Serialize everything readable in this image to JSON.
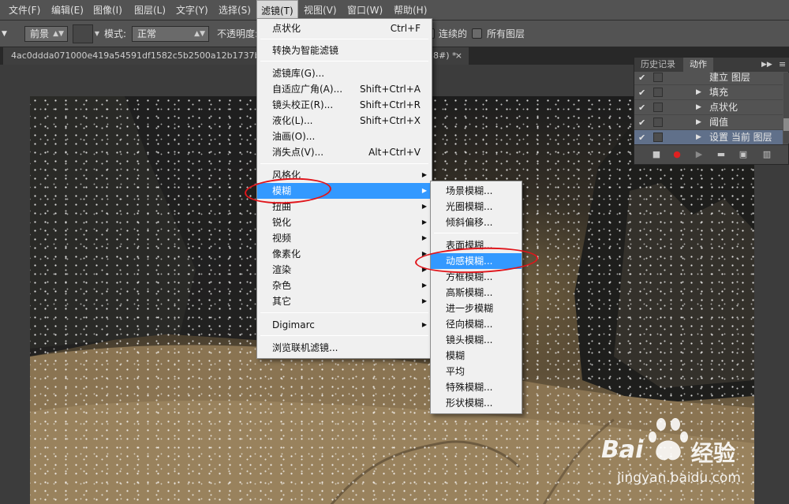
{
  "menubar": {
    "items": [
      {
        "label": "文件(F)"
      },
      {
        "label": "编辑(E)"
      },
      {
        "label": "图像(I)"
      },
      {
        "label": "图层(L)"
      },
      {
        "label": "文字(Y)"
      },
      {
        "label": "选择(S)"
      },
      {
        "label": "滤镜(T)"
      },
      {
        "label": "视图(V)"
      },
      {
        "label": "窗口(W)"
      },
      {
        "label": "帮助(H)"
      }
    ]
  },
  "options": {
    "fill_source": "前景",
    "mode_label": "模式:",
    "mode_value": "正常",
    "opacity_label": "不透明度:",
    "contiguous_label": "连续的",
    "all_layers_label": "所有图层"
  },
  "tab": {
    "title_start": "4ac0ddda071000e419a54591df1582c5b2500a12b1737bb9",
    "title_end": "8#) *",
    "close": "×"
  },
  "filter_menu": {
    "last_filter": {
      "label": "点状化",
      "shortcut": "Ctrl+F"
    },
    "smart": "转换为智能滤镜",
    "gallery": {
      "label": "滤镜库(G)..."
    },
    "adaptive_wide": {
      "label": "自适应广角(A)...",
      "shortcut": "Shift+Ctrl+A"
    },
    "lens_correction": {
      "label": "镜头校正(R)...",
      "shortcut": "Shift+Ctrl+R"
    },
    "liquify": {
      "label": "液化(L)...",
      "shortcut": "Shift+Ctrl+X"
    },
    "oil_paint": {
      "label": "油画(O)..."
    },
    "vanishing_point": {
      "label": "消失点(V)...",
      "shortcut": "Alt+Ctrl+V"
    },
    "stylize": "风格化",
    "blur": "模糊",
    "distort": "扭曲",
    "sharpen": "锐化",
    "video": "视频",
    "pixelate": "像素化",
    "render": "渲染",
    "noise": "杂色",
    "other": "其它",
    "digimarc": "Digimarc",
    "browse_online": "浏览联机滤镜..."
  },
  "blur_menu": {
    "items": [
      "场景模糊...",
      "光圈模糊...",
      "倾斜偏移...",
      "表面模糊...",
      "动感模糊...",
      "方框模糊...",
      "高斯模糊...",
      "进一步模糊",
      "径向模糊...",
      "镜头模糊...",
      "模糊",
      "平均",
      "特殊模糊...",
      "形状模糊..."
    ],
    "highlighted": "动感模糊..."
  },
  "panel": {
    "tab_history": "历史记录",
    "tab_actions": "动作",
    "actions": [
      {
        "label": "建立 图层",
        "expanded": false
      },
      {
        "label": "填充",
        "expanded": false
      },
      {
        "label": "点状化",
        "expanded": false
      },
      {
        "label": "阈值",
        "expanded": false
      },
      {
        "label": "设置 当前 图层",
        "expanded": false
      }
    ]
  },
  "watermark": {
    "brand": "Bai",
    "brand_suffix": "经验",
    "url": "jingyan.baidu.com"
  },
  "colors": {
    "menu_highlight": "#3399ff",
    "annotation_red": "#e0151b",
    "chrome_bg": "#535353"
  }
}
